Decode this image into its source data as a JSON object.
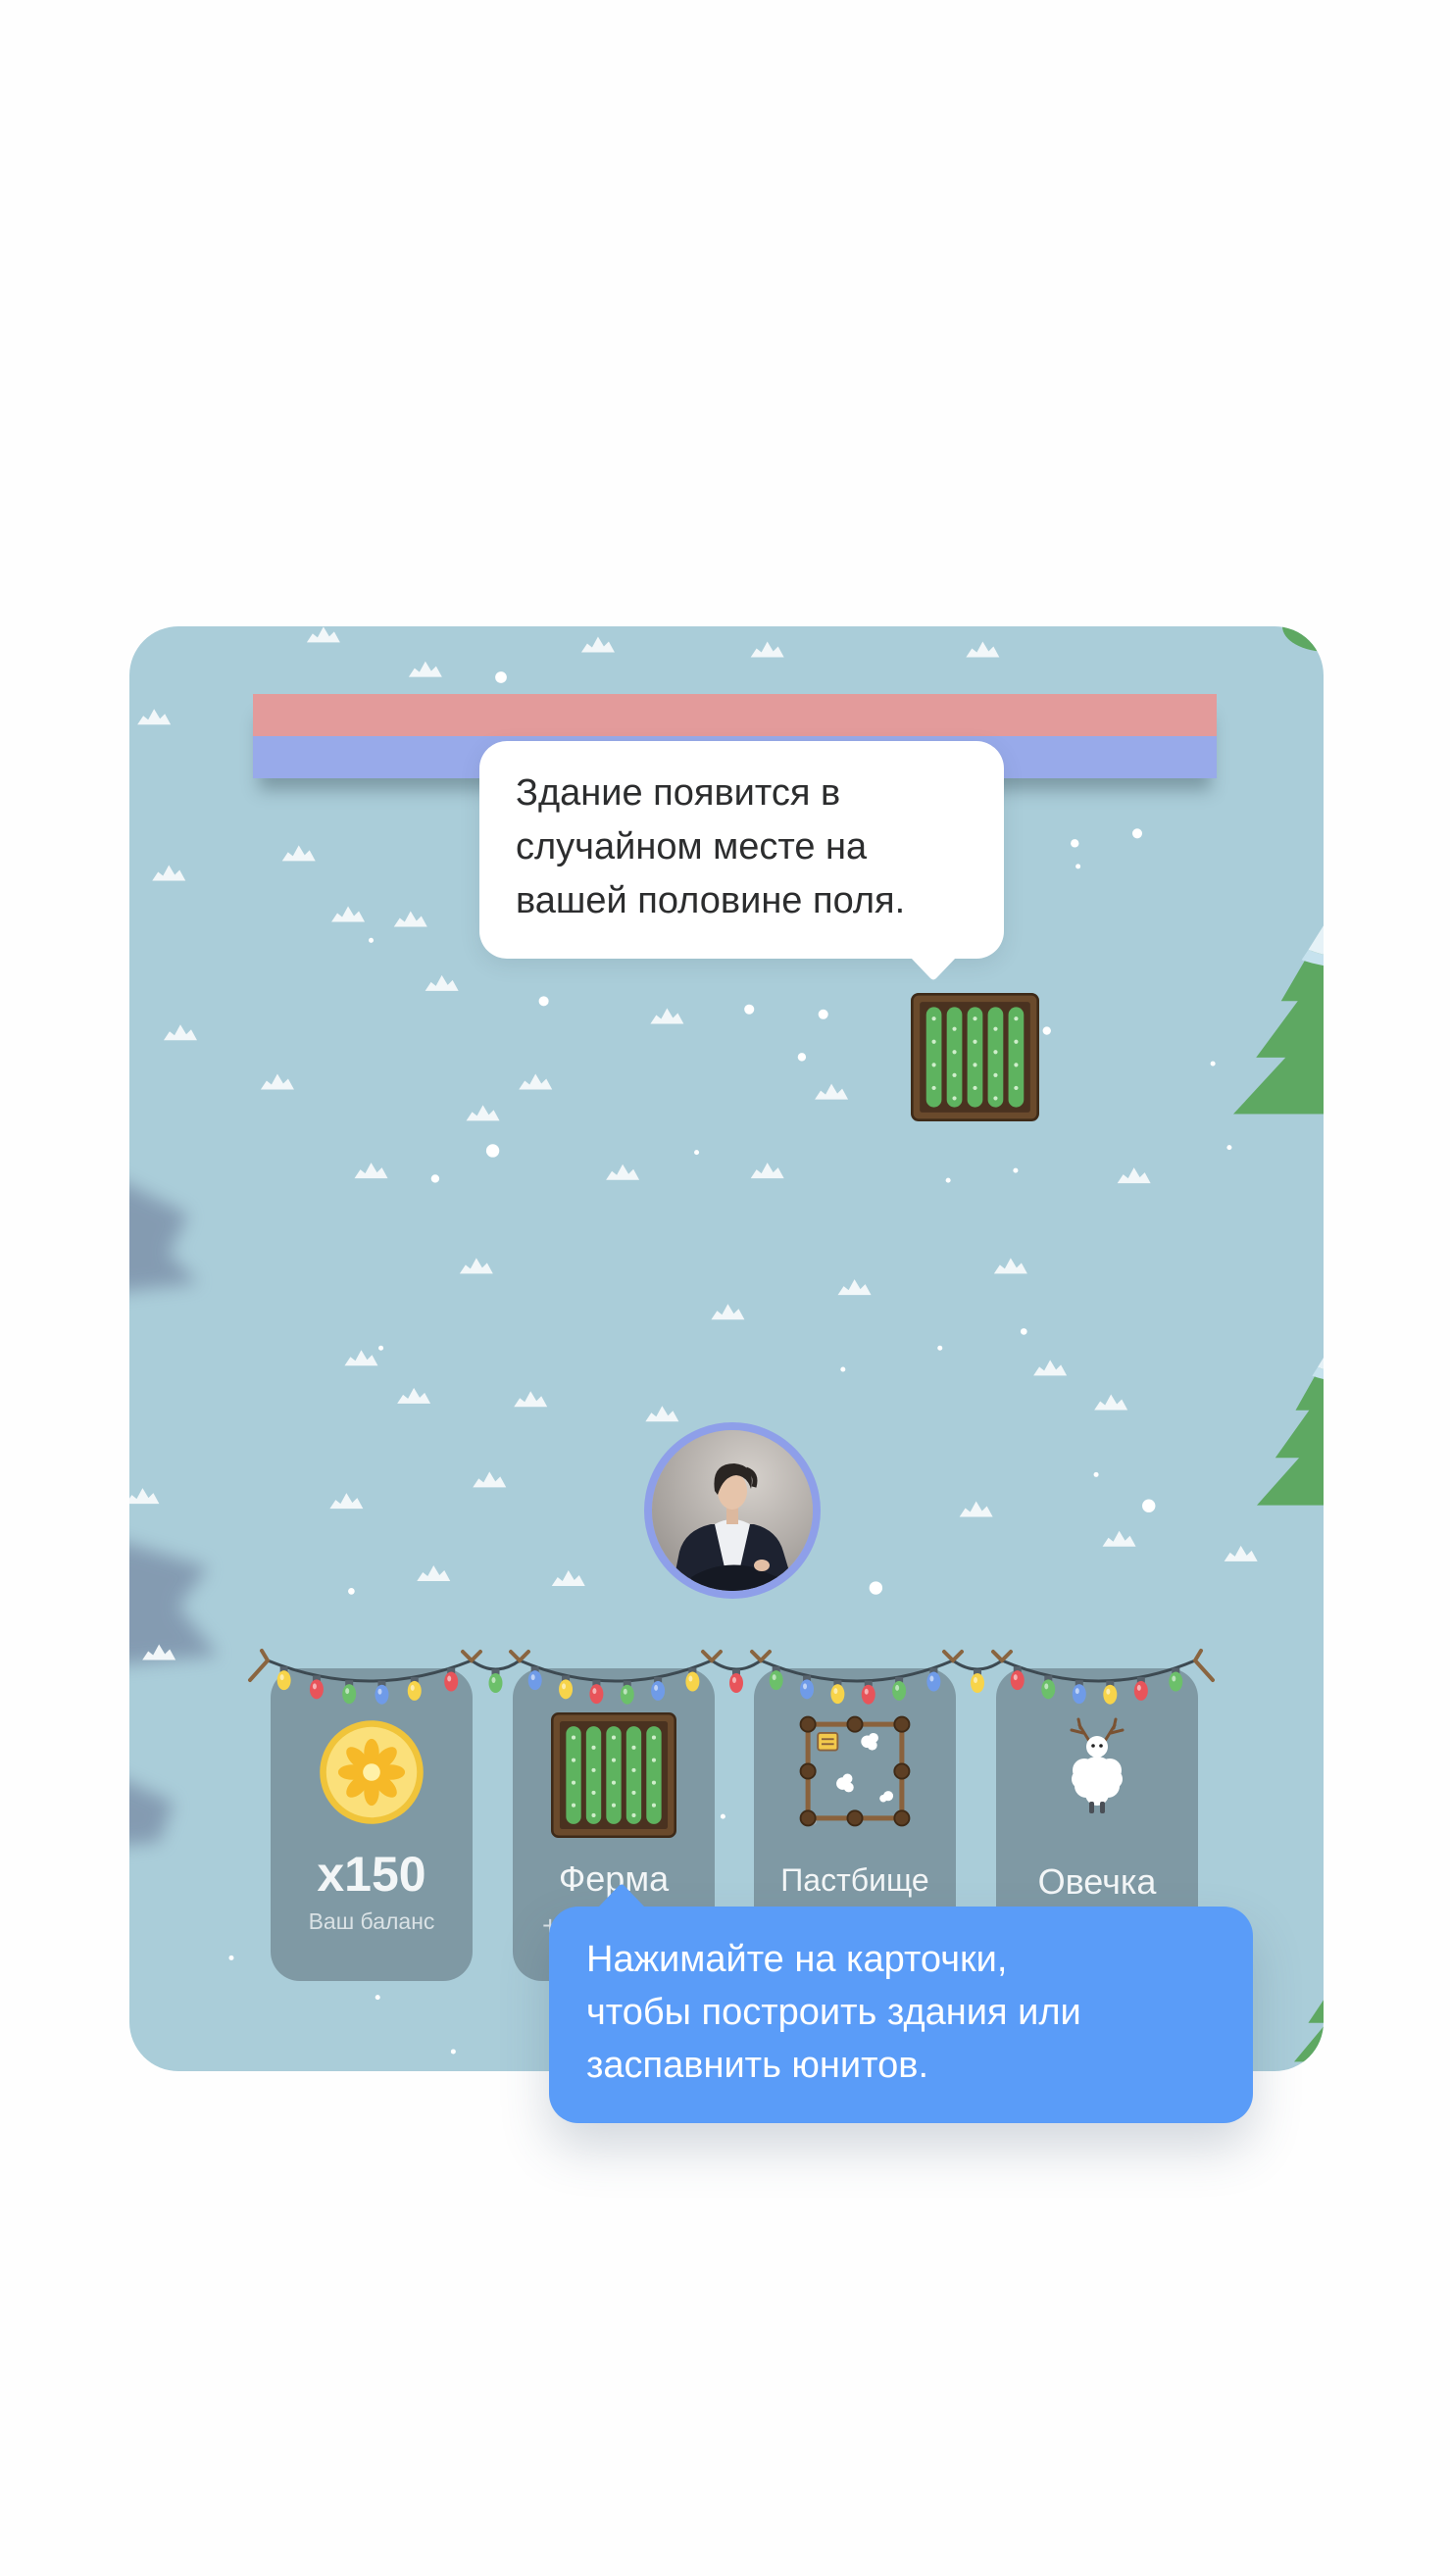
{
  "tooltips": {
    "building_hint": {
      "lines": [
        "Здание появится в",
        "случайном месте на",
        "вашей половине поля."
      ]
    },
    "cards_hint": {
      "lines": [
        "Нажимайте на карточки,",
        "чтобы построить здания или",
        "заспавнить юнитов."
      ]
    }
  },
  "health": {
    "enemy": 1.0,
    "player": 1.0
  },
  "cards": [
    {
      "icon": "coin-icon",
      "value": "x150",
      "label": "Ваш баланс"
    },
    {
      "icon": "farm-icon",
      "title": "Ферма",
      "subtitle": "+"
    },
    {
      "icon": "pasture-icon",
      "title": "Пастбище"
    },
    {
      "icon": "sheep-icon",
      "title": "Овечка"
    }
  ],
  "field": {
    "building_icon": "farm-icon",
    "player_avatar": "avatar-photo"
  },
  "colors": {
    "board_bg": "#aacdd9",
    "enemy_bar": "#e39b9b",
    "player_bar": "#98aaea",
    "avatar_ring": "#8e9fe9",
    "hint_bubble": "#5a9cf8",
    "tree_green": "#5ea862"
  }
}
